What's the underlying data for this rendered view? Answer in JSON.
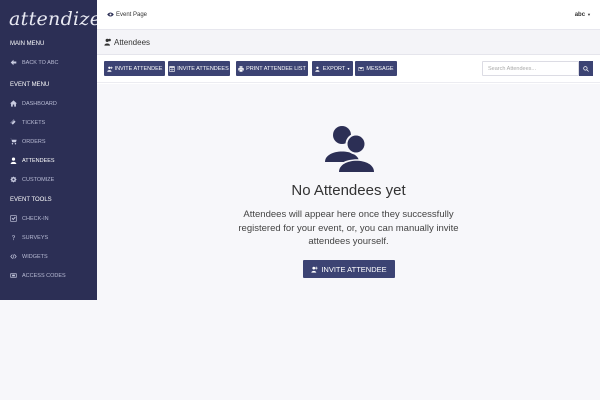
{
  "app": {
    "logo": "attendize"
  },
  "sidebar": {
    "sections": [
      {
        "title": "MAIN MENU",
        "items": [
          {
            "label": "BACK TO ABC",
            "icon": "arrow-left-icon"
          }
        ]
      },
      {
        "title": "EVENT MENU",
        "items": [
          {
            "label": "DASHBOARD",
            "icon": "home-icon"
          },
          {
            "label": "TICKETS",
            "icon": "ticket-icon"
          },
          {
            "label": "ORDERS",
            "icon": "cart-icon"
          },
          {
            "label": "ATTENDEES",
            "icon": "user-icon",
            "active": true
          },
          {
            "label": "CUSTOMIZE",
            "icon": "cog-icon"
          }
        ]
      },
      {
        "title": "EVENT TOOLS",
        "items": [
          {
            "label": "CHECK-IN",
            "icon": "checkbox-icon"
          },
          {
            "label": "SURVEYS",
            "icon": "question-icon"
          },
          {
            "label": "WIDGETS",
            "icon": "code-icon"
          },
          {
            "label": "ACCESS CODES",
            "icon": "ticket-code-icon"
          }
        ]
      }
    ]
  },
  "topbar": {
    "event_page": "Event Page",
    "user": "abc"
  },
  "page_header": {
    "title": "Attendees"
  },
  "toolbar": {
    "invite_attendee": "INVITE ATTENDEE",
    "invite_attendees": "INVITE ATTENDEES",
    "print_list": "PRINT ATTENDEE LIST",
    "export": "EXPORT",
    "message": "MESSAGE",
    "search_placeholder": "Search Attendees..."
  },
  "empty_state": {
    "title": "No Attendees yet",
    "text": "Attendees will appear here once they successfully registered for your event, or, you can manually invite attendees yourself.",
    "button": "INVITE ATTENDEE"
  },
  "colors": {
    "sidebar": "#2c2f55",
    "accent": "#3c4373",
    "background": "#f7f7fa"
  }
}
